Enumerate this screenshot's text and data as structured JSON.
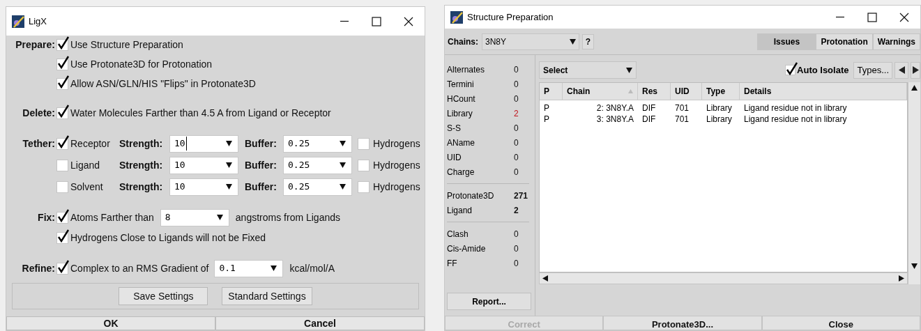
{
  "ligx": {
    "title": "LigX",
    "prepare": {
      "label": "Prepare:",
      "options": [
        {
          "label": "Use Structure Preparation",
          "checked": true
        },
        {
          "label": "Use Protonate3D for Protonation",
          "checked": true
        },
        {
          "label": "Allow ASN/GLN/HIS \"Flips\" in Protonate3D",
          "checked": true
        }
      ]
    },
    "delete": {
      "label": "Delete:",
      "option": {
        "label": "Water Molecules Farther than 4.5 A from Ligand or Receptor",
        "checked": true
      }
    },
    "tether": {
      "label": "Tether:",
      "rows": [
        {
          "label": "Receptor",
          "checked": true,
          "strength_label": "Strength:",
          "strength": "10",
          "focused": true,
          "buffer_label": "Buffer:",
          "buffer": "0.25",
          "hydrogens_label": "Hydrogens",
          "hydrogens_checked": false
        },
        {
          "label": "Ligand",
          "checked": false,
          "strength_label": "Strength:",
          "strength": "10",
          "focused": false,
          "buffer_label": "Buffer:",
          "buffer": "0.25",
          "hydrogens_label": "Hydrogens",
          "hydrogens_checked": false
        },
        {
          "label": "Solvent",
          "checked": false,
          "strength_label": "Strength:",
          "strength": "10",
          "focused": false,
          "buffer_label": "Buffer:",
          "buffer": "0.25",
          "hydrogens_label": "Hydrogens",
          "hydrogens_checked": false
        }
      ]
    },
    "fix": {
      "label": "Fix:",
      "atoms": {
        "label": "Atoms Farther than",
        "checked": true,
        "value": "8",
        "suffix": "angstroms from Ligands"
      },
      "hydrogens": {
        "label": "Hydrogens Close to Ligands will not be Fixed",
        "checked": true
      }
    },
    "refine": {
      "label": "Refine:",
      "option": {
        "label": "Complex to an RMS Gradient of",
        "checked": true,
        "value": "0.1",
        "suffix": "kcal/mol/A"
      }
    },
    "settings_buttons": [
      "Save Settings",
      "Standard Settings"
    ],
    "buttons": [
      "OK",
      "Cancel"
    ]
  },
  "structure_preparation": {
    "title": "Structure Preparation",
    "chains": {
      "label": "Chains:",
      "value": "3N8Y",
      "help": "?"
    },
    "tabs": [
      {
        "label": "Issues",
        "selected": true
      },
      {
        "label": "Protonation",
        "selected": false
      },
      {
        "label": "Warnings",
        "selected": false
      }
    ],
    "stat_groups": [
      [
        {
          "label": "Alternates",
          "value": "0",
          "flagged": false,
          "bold": false
        },
        {
          "label": "Termini",
          "value": "0",
          "flagged": false,
          "bold": false
        },
        {
          "label": "HCount",
          "value": "0",
          "flagged": false,
          "bold": false
        },
        {
          "label": "Library",
          "value": "2",
          "flagged": true,
          "bold": false
        },
        {
          "label": "S-S",
          "value": "0",
          "flagged": false,
          "bold": false
        },
        {
          "label": "AName",
          "value": "0",
          "flagged": false,
          "bold": false
        },
        {
          "label": "UID",
          "value": "0",
          "flagged": false,
          "bold": false
        },
        {
          "label": "Charge",
          "value": "0",
          "flagged": false,
          "bold": false
        }
      ],
      [
        {
          "label": "Protonate3D",
          "value": "271",
          "flagged": false,
          "bold": true
        },
        {
          "label": "Ligand",
          "value": "2",
          "flagged": false,
          "bold": true
        }
      ],
      [
        {
          "label": "Clash",
          "value": "0",
          "flagged": false,
          "bold": false
        },
        {
          "label": "Cis-Amide",
          "value": "0",
          "flagged": false,
          "bold": false
        },
        {
          "label": "FF",
          "value": "0",
          "flagged": false,
          "bold": false
        }
      ]
    ],
    "report_button": "Report...",
    "select": "Select",
    "auto_isolate": {
      "label": "Auto Isolate",
      "checked": true
    },
    "types_button": "Types...",
    "table": {
      "columns": [
        "P",
        "Chain",
        "Res",
        "UID",
        "Type",
        "Details"
      ],
      "rows": [
        [
          "P",
          "2: 3N8Y.A",
          "DIF",
          "701",
          "Library",
          "Ligand residue not in library"
        ],
        [
          "P",
          "3: 3N8Y.A",
          "DIF",
          "701",
          "Library",
          "Ligand residue not in library"
        ]
      ]
    },
    "buttons": [
      {
        "label": "Correct",
        "disabled": true
      },
      {
        "label": "Protonate3D...",
        "disabled": false
      },
      {
        "label": "Close",
        "disabled": false
      }
    ]
  }
}
